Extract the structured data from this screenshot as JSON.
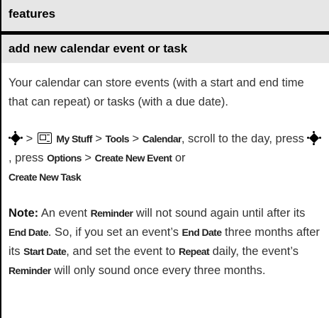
{
  "header": {
    "title": "features"
  },
  "section": {
    "title": "add new calendar event or task",
    "intro": "Your calendar can store events (with a start and end time that can repeat) or tasks (with a due date).",
    "steps": {
      "sep1": " > ",
      "my_stuff": "My Stuff",
      "sep2": " > ",
      "tools": "Tools",
      "sep3": " > ",
      "calendar": "Calendar",
      "text1": ", scroll to the day, press ",
      "text2": ", press ",
      "options": "Options",
      "sep4": " > ",
      "create_event": "Create New Event",
      "text3": " or ",
      "create_task": "Create New Task"
    },
    "note": {
      "label": "Note:",
      "t1": " An event ",
      "reminder1": "Reminder",
      "t2": " will not sound again until after its ",
      "end_date1": "End Date",
      "t3": ". So, if you set an event’s ",
      "end_date2": "End Date",
      "t4": " three months after its ",
      "start_date": "Start Date",
      "t5": ", and set the event to ",
      "repeat": "Repeat",
      "t6": " daily, the event’s ",
      "reminder2": "Reminder",
      "t7": " will only sound once every three months."
    }
  },
  "icons": {
    "nav_key": "nav-key-icon",
    "my_stuff": "my-stuff-icon"
  }
}
